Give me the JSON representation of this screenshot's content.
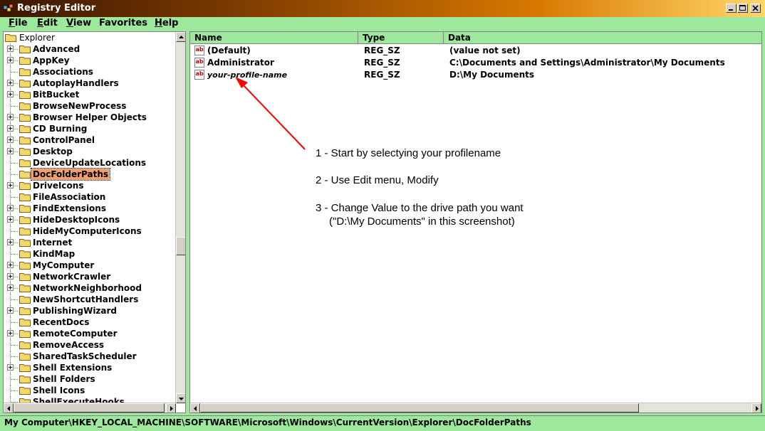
{
  "window": {
    "title": "Registry Editor"
  },
  "menu": [
    {
      "label": "File",
      "key": "F",
      "rest": "ile"
    },
    {
      "label": "Edit",
      "key": "E",
      "rest": "dit"
    },
    {
      "label": "View",
      "key": "V",
      "rest": "iew"
    },
    {
      "label": "Favorites",
      "key": "F",
      "rest": "avorites",
      "pre": ""
    },
    {
      "label": "Help",
      "key": "H",
      "rest": "elp"
    }
  ],
  "tree": {
    "root": "Explorer",
    "items": [
      {
        "label": "Advanced",
        "expandable": true
      },
      {
        "label": "AppKey",
        "expandable": true
      },
      {
        "label": "Associations",
        "expandable": false
      },
      {
        "label": "AutoplayHandlers",
        "expandable": true
      },
      {
        "label": "BitBucket",
        "expandable": true
      },
      {
        "label": "BrowseNewProcess",
        "expandable": false
      },
      {
        "label": "Browser Helper Objects",
        "expandable": true
      },
      {
        "label": "CD Burning",
        "expandable": true
      },
      {
        "label": "ControlPanel",
        "expandable": true
      },
      {
        "label": "Desktop",
        "expandable": true
      },
      {
        "label": "DeviceUpdateLocations",
        "expandable": false
      },
      {
        "label": "DocFolderPaths",
        "expandable": false,
        "selected": true
      },
      {
        "label": "DriveIcons",
        "expandable": true
      },
      {
        "label": "FileAssociation",
        "expandable": false
      },
      {
        "label": "FindExtensions",
        "expandable": true
      },
      {
        "label": "HideDesktopIcons",
        "expandable": true
      },
      {
        "label": "HideMyComputerIcons",
        "expandable": false
      },
      {
        "label": "Internet",
        "expandable": true
      },
      {
        "label": "KindMap",
        "expandable": false
      },
      {
        "label": "MyComputer",
        "expandable": true
      },
      {
        "label": "NetworkCrawler",
        "expandable": true
      },
      {
        "label": "NetworkNeighborhood",
        "expandable": true
      },
      {
        "label": "NewShortcutHandlers",
        "expandable": false
      },
      {
        "label": "PublishingWizard",
        "expandable": true
      },
      {
        "label": "RecentDocs",
        "expandable": false
      },
      {
        "label": "RemoteComputer",
        "expandable": true
      },
      {
        "label": "RemoveAccess",
        "expandable": false
      },
      {
        "label": "SharedTaskScheduler",
        "expandable": false
      },
      {
        "label": "Shell Extensions",
        "expandable": true
      },
      {
        "label": "Shell Folders",
        "expandable": false
      },
      {
        "label": "Shell Icons",
        "expandable": false
      },
      {
        "label": "ShellExecuteHooks",
        "expandable": false
      }
    ]
  },
  "list": {
    "columns": {
      "name": "Name",
      "type": "Type",
      "data": "Data"
    },
    "rows": [
      {
        "name": "(Default)",
        "type": "REG_SZ",
        "data": "(value not set)",
        "italic": false
      },
      {
        "name": "Administrator",
        "type": "REG_SZ",
        "data": "C:\\Documents and Settings\\Administrator\\My Documents",
        "italic": false
      },
      {
        "name": "your-profile-name",
        "type": "REG_SZ",
        "data": "D:\\My Documents",
        "italic": true
      }
    ],
    "icon_text": "ab"
  },
  "annotations": {
    "step1": "1 - Start by selectying your profilename",
    "step2": "2 - Use Edit menu, Modify",
    "step3": "3 - Change Value to the drive path you want",
    "step3b": "(\"D:\\My Documents\" in this screenshot)",
    "arrow_color": "#ff0000"
  },
  "status": {
    "path": "My Computer\\HKEY_LOCAL_MACHINE\\SOFTWARE\\Microsoft\\Windows\\CurrentVersion\\Explorer\\DocFolderPaths"
  },
  "colors": {
    "background": "#9ee89e",
    "selection": "#f0a070",
    "folder": "#f5d86a"
  },
  "icons": {
    "app": "registry-editor-icon",
    "folder": "folder-icon",
    "value": "string-value-icon"
  }
}
